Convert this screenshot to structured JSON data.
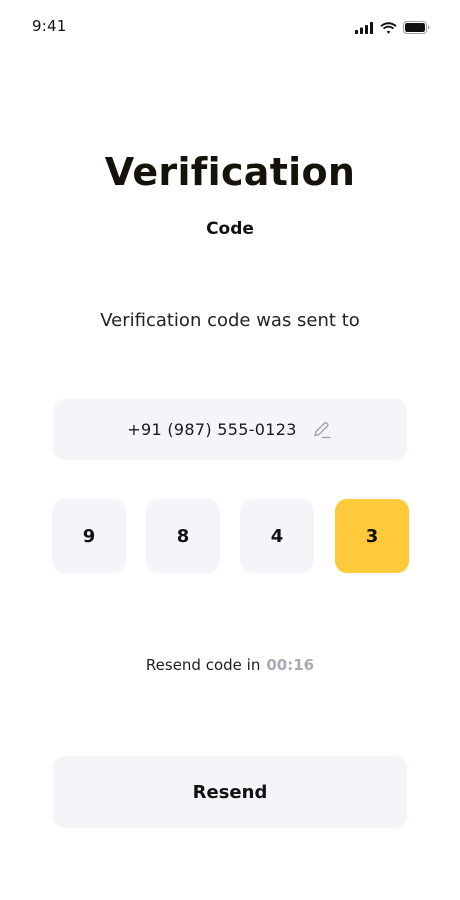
{
  "status_bar": {
    "time": "9:41",
    "icons": [
      "signal-icon",
      "wifi-icon",
      "battery-icon"
    ]
  },
  "header": {
    "title": "Verification",
    "subtitle": "Code"
  },
  "info": {
    "sent_to_text": "Verification code was sent to",
    "phone_number": "+91 (987) 555-0123",
    "edit_icon": "pencil-icon"
  },
  "code": {
    "digits": [
      "9",
      "8",
      "4",
      "3"
    ],
    "active_index": 3
  },
  "resend": {
    "label": "Resend code in",
    "timer": "00:16",
    "button_label": "Resend"
  },
  "colors": {
    "accent": "#ffc93c",
    "field_bg": "#f4f5f9",
    "timer": "#a8abb3",
    "text": "#111111"
  }
}
